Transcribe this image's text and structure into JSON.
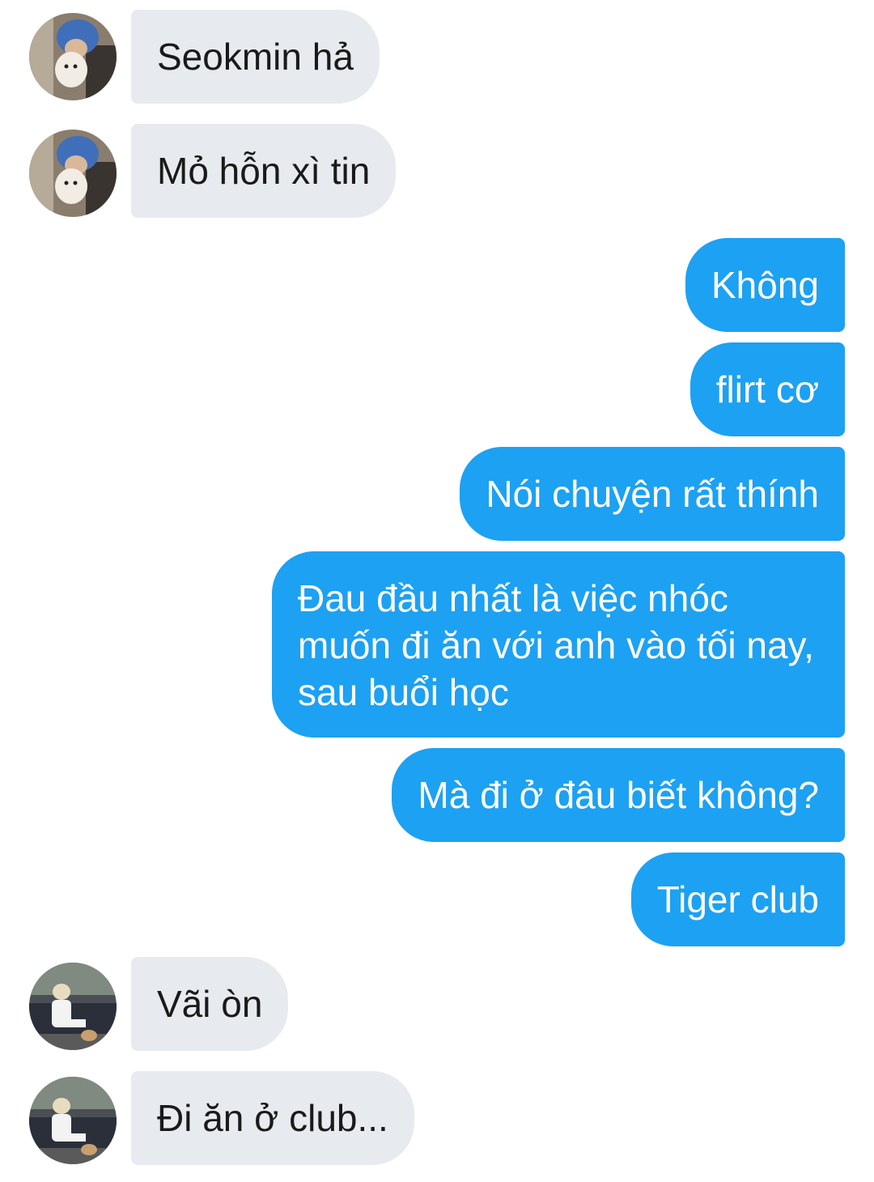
{
  "conversation": {
    "messages": [
      {
        "direction": "incoming",
        "text": "Seokmin hả",
        "avatar": "avatar-blue-hair-with-dog"
      },
      {
        "direction": "incoming",
        "text": "Mỏ hỗn xì tin",
        "avatar": "avatar-blue-hair-with-dog"
      },
      {
        "direction": "outgoing",
        "text": "Không"
      },
      {
        "direction": "outgoing",
        "text": "flirt cơ"
      },
      {
        "direction": "outgoing",
        "text": "Nói chuyện rất thính"
      },
      {
        "direction": "outgoing",
        "text": "Đau đầu nhất là việc nhóc muốn đi ăn với anh vào tối nay, sau buổi học"
      },
      {
        "direction": "outgoing",
        "text": "Mà đi ở đâu biết không?"
      },
      {
        "direction": "outgoing",
        "text": "Tiger club"
      },
      {
        "direction": "incoming",
        "text": "Vãi òn",
        "avatar": "avatar-blonde-by-car"
      },
      {
        "direction": "incoming",
        "text": "Đi ăn ở club...",
        "avatar": "avatar-blonde-by-car"
      }
    ]
  },
  "colors": {
    "outgoing_bubble": "#1da1f2",
    "incoming_bubble": "#e7ebef",
    "background": "#ffffff"
  }
}
